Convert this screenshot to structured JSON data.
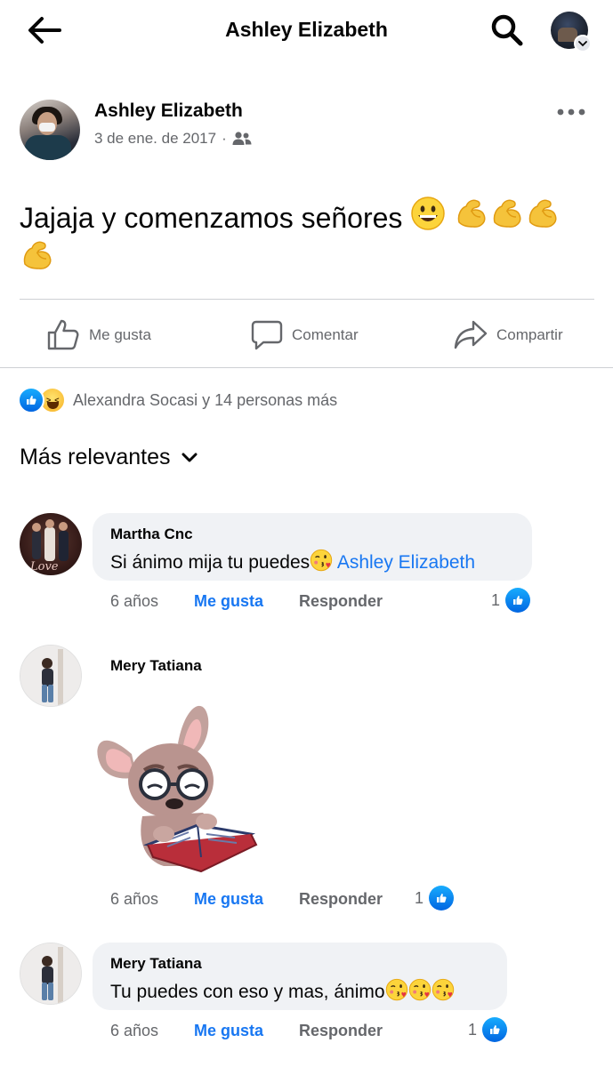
{
  "header": {
    "title": "Ashley Elizabeth"
  },
  "post": {
    "author": "Ashley Elizabeth",
    "date": "3 de ene. de 2017",
    "separator": "·",
    "audience_icon": "friends-icon",
    "text": "Jajaja y comenzamos señores"
  },
  "actions": {
    "like": "Me gusta",
    "comment": "Comentar",
    "share": "Compartir"
  },
  "reactions": {
    "summary": "Alexandra Socasi y 14 personas más",
    "types": [
      "like",
      "haha"
    ]
  },
  "sort": {
    "label": "Más relevantes"
  },
  "comments": [
    {
      "author": "Martha Cnc",
      "text": "Si ánimo mija tu puedes",
      "tag": "Ashley Elizabeth",
      "age": "6 años",
      "like_label": "Me gusta",
      "reply_label": "Responder",
      "likes": "1"
    },
    {
      "author": "Mery Tatiana",
      "sticker": "dog-reading-book-sticker",
      "age": "6 años",
      "like_label": "Me gusta",
      "reply_label": "Responder",
      "likes": "1"
    },
    {
      "author": "Mery Tatiana",
      "text": "Tu puedes con eso y mas, ánimo",
      "age": "6 años",
      "like_label": "Me gusta",
      "reply_label": "Responder",
      "likes": "1"
    }
  ],
  "colors": {
    "accent": "#1877f2",
    "secondary_text": "#65676b",
    "bubble": "#f0f2f5",
    "divider": "#ced0d4"
  }
}
